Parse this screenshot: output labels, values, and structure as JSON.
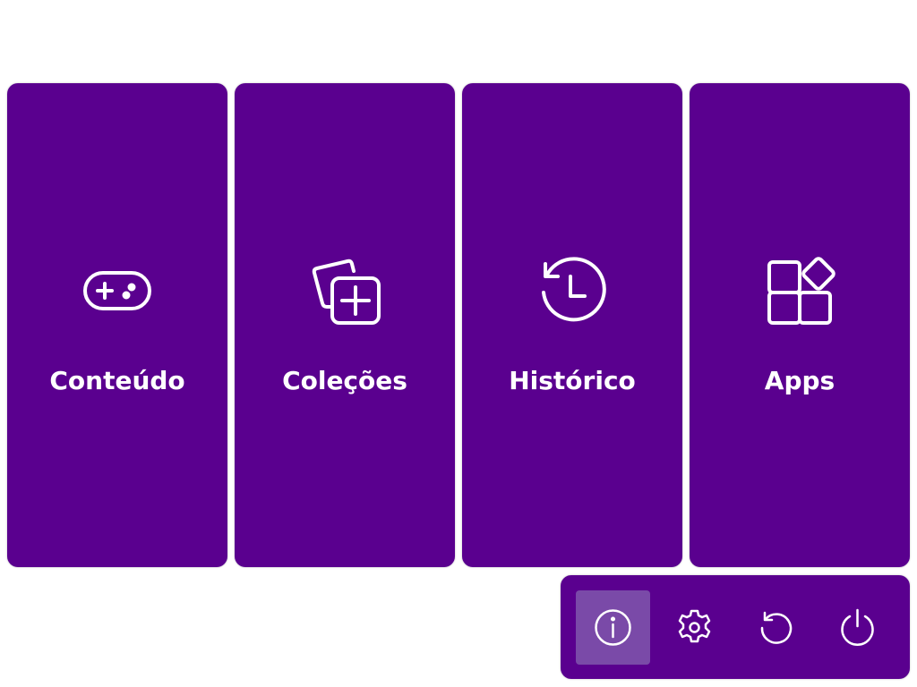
{
  "accent_color": "#5a008f",
  "active_color": "#7a4aa8",
  "tiles": [
    {
      "label": "Conteúdo",
      "icon": "gamepad-icon"
    },
    {
      "label": "Coleções",
      "icon": "collection-add-icon"
    },
    {
      "label": "Histórico",
      "icon": "history-icon"
    },
    {
      "label": "Apps",
      "icon": "apps-icon"
    }
  ],
  "toolbar": [
    {
      "icon": "info-icon",
      "active": true
    },
    {
      "icon": "settings-icon",
      "active": false
    },
    {
      "icon": "restart-icon",
      "active": false
    },
    {
      "icon": "power-icon",
      "active": false
    }
  ]
}
